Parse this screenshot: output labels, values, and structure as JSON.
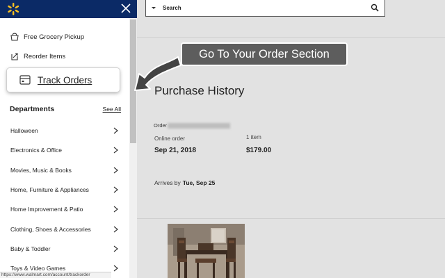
{
  "sidebar": {
    "quick_links": [
      {
        "label": "Free Grocery Pickup",
        "icon": "store-pickup-icon"
      },
      {
        "label": "Reorder Items",
        "icon": "reorder-icon"
      }
    ],
    "track_orders": {
      "label": "Track Orders",
      "icon": "box-icon"
    },
    "departments": {
      "title": "Departments",
      "see_all": "See All",
      "items": [
        {
          "label": "Halloween"
        },
        {
          "label": "Electronics & Office"
        },
        {
          "label": "Movies, Music & Books"
        },
        {
          "label": "Home, Furniture & Appliances"
        },
        {
          "label": "Home Improvement & Patio"
        },
        {
          "label": "Clothing, Shoes & Accessories"
        },
        {
          "label": "Baby & Toddler"
        },
        {
          "label": "Toys & Video Games"
        }
      ]
    },
    "status_url": "https://www.walmart.com/account/trackorder"
  },
  "search": {
    "label": "Search"
  },
  "callout": {
    "text": "Go To Your Order Section"
  },
  "purchase_history": {
    "title": "Purchase History",
    "order_label": "Order",
    "online_order_label": "Online order",
    "date": "Sep 21, 2018",
    "items_count": "1 item",
    "total": "$179.00",
    "arrives_label": "Arrives by",
    "arrives_date": "Tue, Sep 25"
  },
  "colors": {
    "header_navy": "#0b2a66",
    "spark_yellow": "#ffc220",
    "callout_gray": "#5d5d5d",
    "overlay_gray": "#e2e2e2"
  }
}
